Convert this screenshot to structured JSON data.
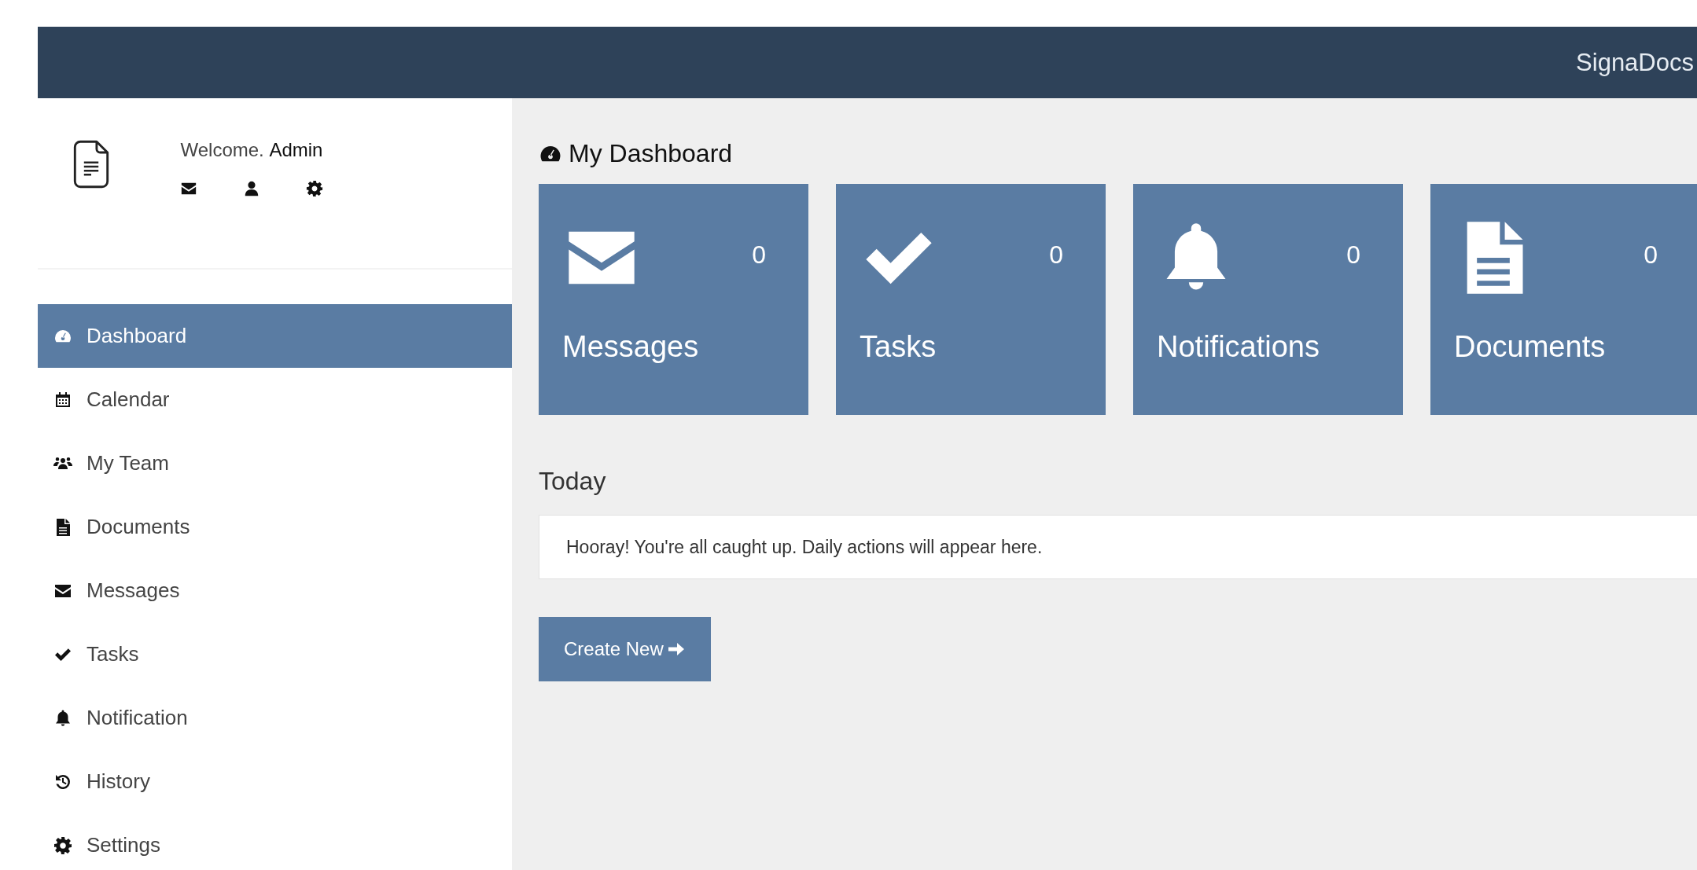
{
  "header": {
    "brand": "SignaDocs"
  },
  "sidebar": {
    "welcome": "Welcome. **Admin**",
    "items": [
      {
        "label": "Dashboard",
        "selected": true
      },
      {
        "label": "Calendar",
        "selected": false
      },
      {
        "label": "My Team",
        "selected": false
      },
      {
        "label": "Documents",
        "selected": false
      },
      {
        "label": "Messages",
        "selected": false
      },
      {
        "label": "Tasks",
        "selected": false
      },
      {
        "label": "Notification",
        "selected": false
      },
      {
        "label": "History",
        "selected": false
      },
      {
        "label": "Settings",
        "selected": false
      }
    ]
  },
  "main": {
    "title": "My Dashboard",
    "cards": [
      {
        "label": "Messages",
        "count": "0"
      },
      {
        "label": "Tasks",
        "count": "0"
      },
      {
        "label": "Notifications",
        "count": "0"
      },
      {
        "label": "Documents",
        "count": "0"
      }
    ],
    "today": {
      "heading": "Today",
      "message": "Hooray! You're all caught up. Daily actions will appear here."
    },
    "create_button": "Create New"
  }
}
